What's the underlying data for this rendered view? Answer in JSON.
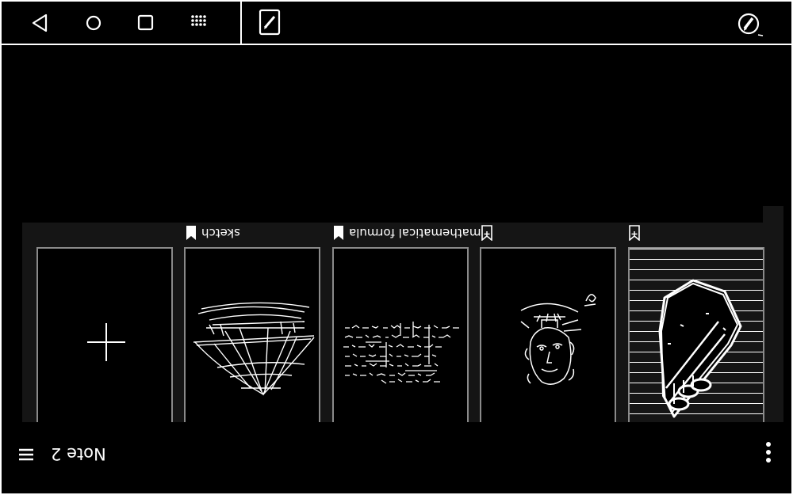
{
  "nav": {
    "back_icon": "back-triangle-icon",
    "home_icon": "home-circle-icon",
    "recent_icon": "recent-square-icon",
    "apps_icon": "apps-grid-icon"
  },
  "app": {
    "icon": "note-edit-icon",
    "pen_icon": "pen-icon"
  },
  "notebook": {
    "title": "Note 2"
  },
  "notes": [
    {
      "label": "",
      "tag": "none",
      "thumb": "new-note-plus"
    },
    {
      "label": "sketch",
      "tag": "bookmark-filled",
      "thumb": "sailing-ship-sketch"
    },
    {
      "label": "mathematical formula",
      "tag": "bookmark-filled",
      "thumb": "formula-handwriting"
    },
    {
      "label": "",
      "tag": "bookmark-add",
      "thumb": "face-sketch"
    },
    {
      "label": "",
      "tag": "bookmark-add",
      "thumb": "3d-pipe-drawing"
    }
  ],
  "colors": {
    "background": "#000000",
    "panel": "#151515",
    "card_border": "#8a8a8a",
    "foreground": "#ffffff"
  }
}
